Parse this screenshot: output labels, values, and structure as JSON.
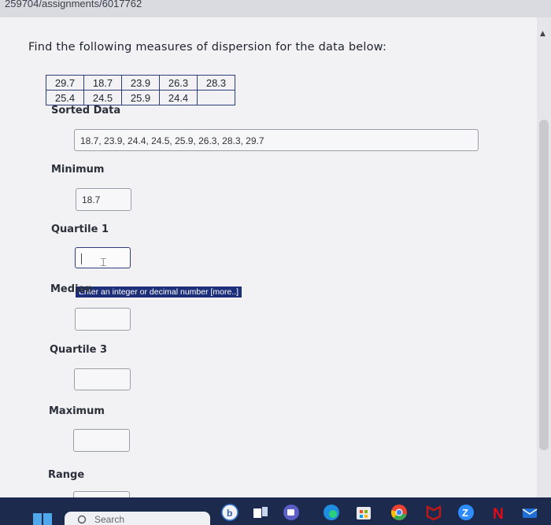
{
  "browser": {
    "url_fragment": "259704/assignments/6017762"
  },
  "question": {
    "heading": "Find the following measures of dispersion for the data below:",
    "table": [
      [
        "29.7",
        "18.7",
        "23.9",
        "26.3",
        "28.3"
      ],
      [
        "25.4",
        "24.5",
        "25.9",
        "24.4",
        ""
      ]
    ]
  },
  "fields": {
    "sorted": {
      "label": "Sorted Data",
      "value": "18.7, 23.9, 24.4, 24.5, 25.9, 26.3, 28.3, 29.7"
    },
    "minimum": {
      "label": "Minimum",
      "value": "18.7"
    },
    "quartile1": {
      "label": "Quartile 1",
      "value": "",
      "tooltip": "Enter an integer or decimal number [more..]"
    },
    "median": {
      "label": "Median",
      "value": ""
    },
    "quartile3": {
      "label": "Quartile 3",
      "value": ""
    },
    "maximum": {
      "label": "Maximum",
      "value": ""
    },
    "range": {
      "label": "Range",
      "value": ""
    }
  },
  "taskbar": {
    "search_placeholder": "Search",
    "icons": [
      "windows-start-icon",
      "search-icon",
      "bing-icon",
      "task-view-icon",
      "teams-icon",
      "edge-icon",
      "store-icon",
      "chrome-icon",
      "mcafee-icon",
      "zoom-icon",
      "netflix-icon",
      "mail-icon"
    ]
  }
}
